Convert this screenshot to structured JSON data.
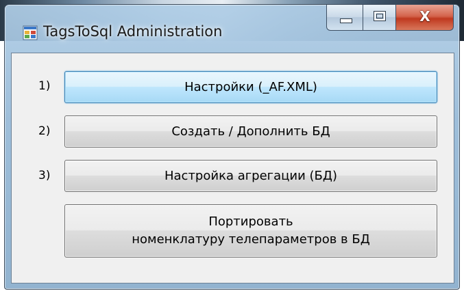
{
  "window": {
    "title": "TagsToSql Administration",
    "close_glyph": "X"
  },
  "steps": [
    {
      "number": "1)",
      "label": "Настройки (_AF.XML)"
    },
    {
      "number": "2)",
      "label": "Создать / Дополнить БД"
    },
    {
      "number": "3)",
      "label": "Настройка агрегации (БД)"
    }
  ],
  "port_button": {
    "line1": "Портировать",
    "line2": "номенклатуру телепараметров в БД"
  },
  "icons": {
    "app": "application-window-icon",
    "minimize": "minimize-icon",
    "maximize": "maximize-icon",
    "close": "close-icon"
  }
}
